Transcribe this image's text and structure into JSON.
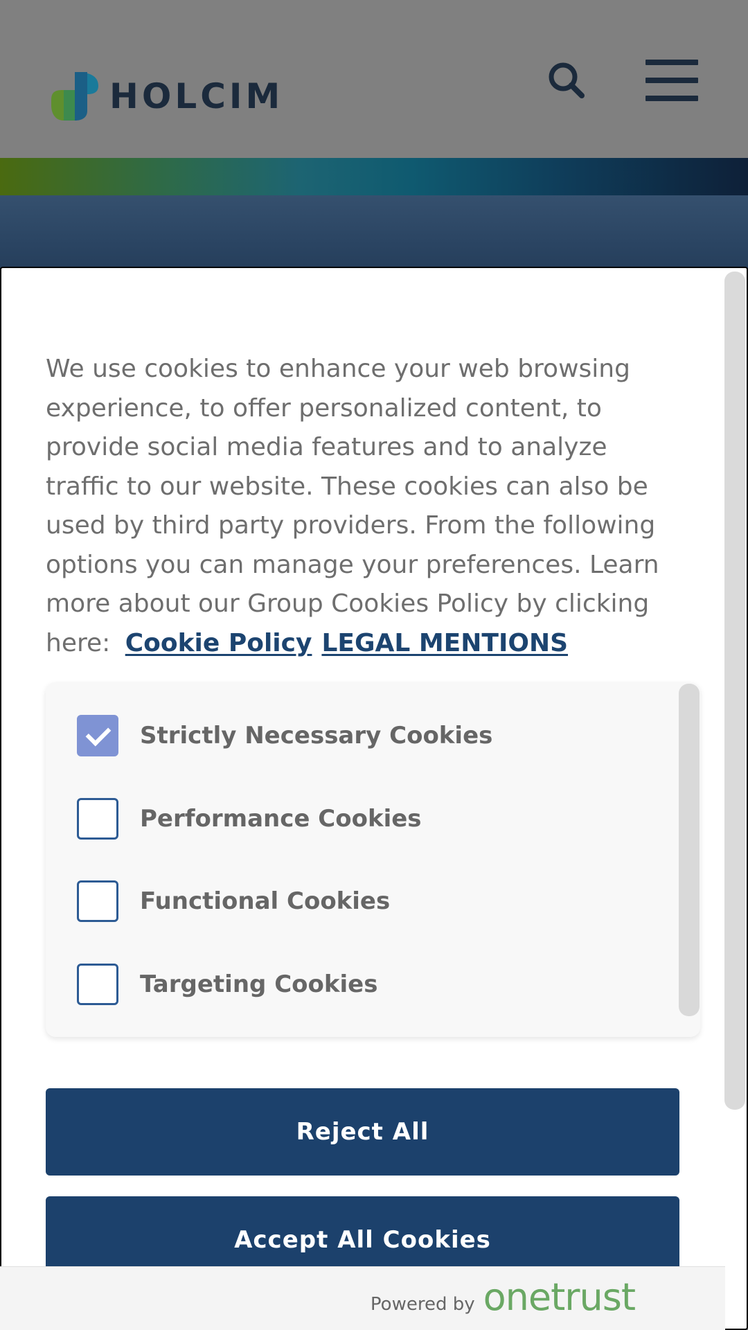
{
  "header": {
    "logo_text": "HOLCIM",
    "logo_colors": {
      "green": "#5f8f2e",
      "teal": "#1a7a9a"
    },
    "search_icon": "search-icon",
    "menu_icon": "hamburger-menu-icon"
  },
  "cookie_dialog": {
    "intro_text": "We use cookies to enhance your web browsing experience, to offer personalized content, to provide social media features and to analyze traffic to our website. These cookies can also be used by third party providers. From the following options you can manage your preferences. Learn more about our Group Cookies Policy by clicking here:",
    "links": {
      "cookie_policy": "Cookie Policy",
      "legal_mentions": "LEGAL MENTIONS"
    },
    "categories": [
      {
        "label": "Strictly Necessary Cookies",
        "checked": true
      },
      {
        "label": "Performance Cookies",
        "checked": false
      },
      {
        "label": "Functional Cookies",
        "checked": false
      },
      {
        "label": "Targeting Cookies",
        "checked": false
      }
    ],
    "buttons": {
      "reject_all": "Reject All",
      "accept_all": "Accept All Cookies"
    },
    "footer": {
      "powered_by": "Powered by",
      "brand": "onetrust"
    },
    "colors": {
      "button_bg": "#1c416c",
      "link": "#1c4470",
      "checkbox_checked": "#7f93d4",
      "brand_green": "#6aa864"
    }
  }
}
